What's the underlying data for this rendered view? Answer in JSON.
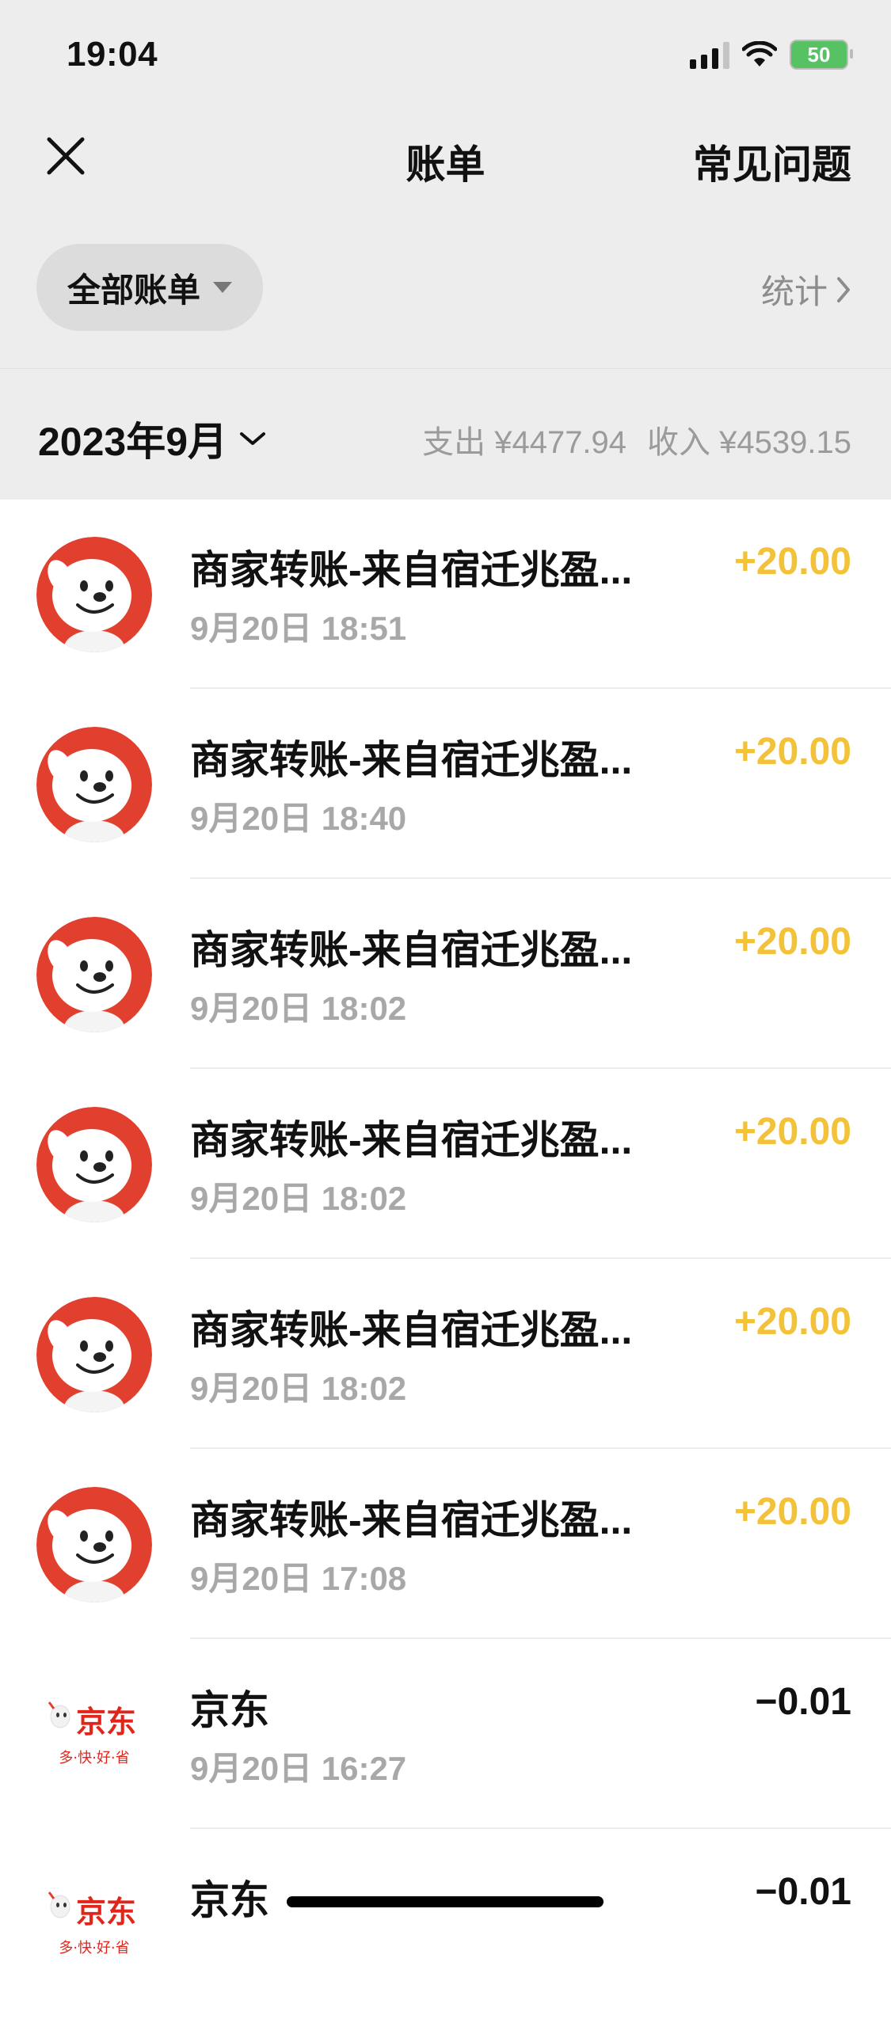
{
  "status_bar": {
    "time": "19:04",
    "battery": "50"
  },
  "nav": {
    "title": "账单",
    "faq_label": "常见问题"
  },
  "filter": {
    "label": "全部账单",
    "stats_label": "统计"
  },
  "month_header": {
    "month": "2023年9月",
    "expense": "支出 ¥4477.94",
    "income": "收入 ¥4539.15"
  },
  "colors": {
    "income": "#f2c23a",
    "avatar_red": "#e2402f",
    "background": "#ededed"
  },
  "transactions": [
    {
      "title": "商家转账-来自宿迁兆盈...",
      "time": "9月20日 18:51",
      "amount": "+20.00",
      "type": "income",
      "avatar": "jd-mascot-icon"
    },
    {
      "title": "商家转账-来自宿迁兆盈...",
      "time": "9月20日 18:40",
      "amount": "+20.00",
      "type": "income",
      "avatar": "jd-mascot-icon"
    },
    {
      "title": "商家转账-来自宿迁兆盈...",
      "time": "9月20日 18:02",
      "amount": "+20.00",
      "type": "income",
      "avatar": "jd-mascot-icon"
    },
    {
      "title": "商家转账-来自宿迁兆盈...",
      "time": "9月20日 18:02",
      "amount": "+20.00",
      "type": "income",
      "avatar": "jd-mascot-icon"
    },
    {
      "title": "商家转账-来自宿迁兆盈...",
      "time": "9月20日 18:02",
      "amount": "+20.00",
      "type": "income",
      "avatar": "jd-mascot-icon"
    },
    {
      "title": "商家转账-来自宿迁兆盈...",
      "time": "9月20日 17:08",
      "amount": "+20.00",
      "type": "income",
      "avatar": "jd-mascot-icon"
    },
    {
      "title": "京东",
      "time": "9月20日 16:27",
      "amount": "−0.01",
      "type": "expense",
      "avatar": "jd-logo-icon",
      "logo_text": "京东",
      "logo_slogan": "多·快·好·省"
    },
    {
      "title": "京东",
      "time": "",
      "amount": "−0.01",
      "type": "expense",
      "avatar": "jd-logo-icon",
      "logo_text": "京东",
      "logo_slogan": "多·快·好·省"
    }
  ]
}
